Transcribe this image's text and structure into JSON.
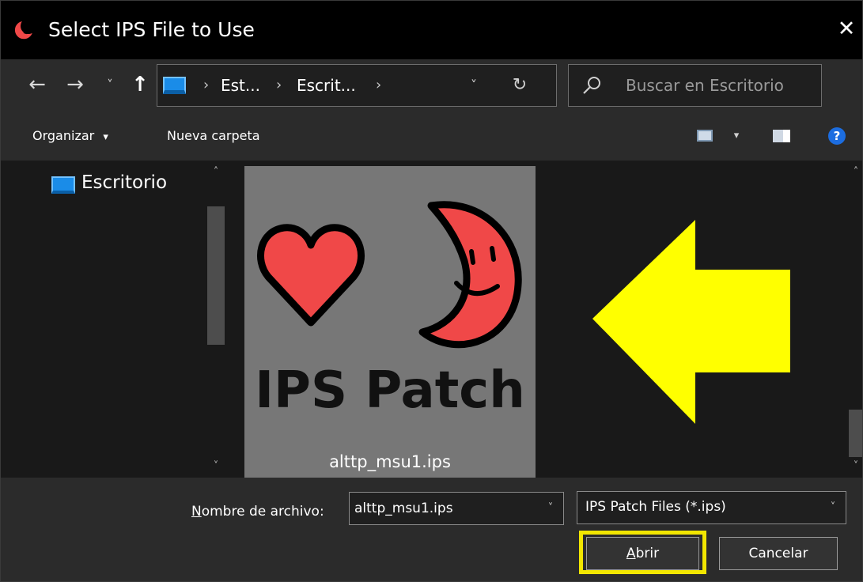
{
  "window": {
    "title": "Select IPS File to Use",
    "close_glyph": "✕",
    "icon": "app-moon-icon"
  },
  "nav": {
    "back_glyph": "←",
    "forward_glyph": "→",
    "recent_glyph": "˅",
    "up_glyph": "↑",
    "breadcrumbs": [
      "Est...",
      "Escrit..."
    ],
    "sep_glyph": "›",
    "dropdown_glyph": "˅",
    "refresh_glyph": "↻",
    "search_placeholder": "Buscar en Escritorio"
  },
  "toolbar": {
    "organize_label": "Organizar",
    "organize_caret": "▾",
    "new_folder_label": "Nueva carpeta",
    "view_caret": "▾",
    "help_glyph": "?"
  },
  "tree": {
    "items": [
      {
        "label": "Escritorio",
        "icon": "desktop-icon"
      }
    ]
  },
  "files": [
    {
      "name": "alttp_msu1.ips",
      "thumbnail_text": "IPS Patch",
      "thumbnail_colors": {
        "background": "#777777",
        "heart": "#f04848",
        "moon": "#f04848",
        "outline": "#000000"
      }
    }
  ],
  "annotation": {
    "arrow_color": "#ffff00",
    "highlight_color": "#f2e600"
  },
  "footer": {
    "filename_label_u": "N",
    "filename_label_rest": "ombre de archivo:",
    "filename_value": "alttp_msu1.ips",
    "filetype_value": "IPS Patch Files (*.ips)",
    "combo_glyph": "˅",
    "open_label_u": "A",
    "open_label_rest": "brir",
    "cancel_label": "Cancelar"
  },
  "scroll": {
    "up_glyph": "˄",
    "down_glyph": "˅"
  },
  "colors": {
    "accent": "#1a8ce8",
    "panel": "#2b2b2b",
    "background": "#191919",
    "titlebar": "#000000"
  }
}
